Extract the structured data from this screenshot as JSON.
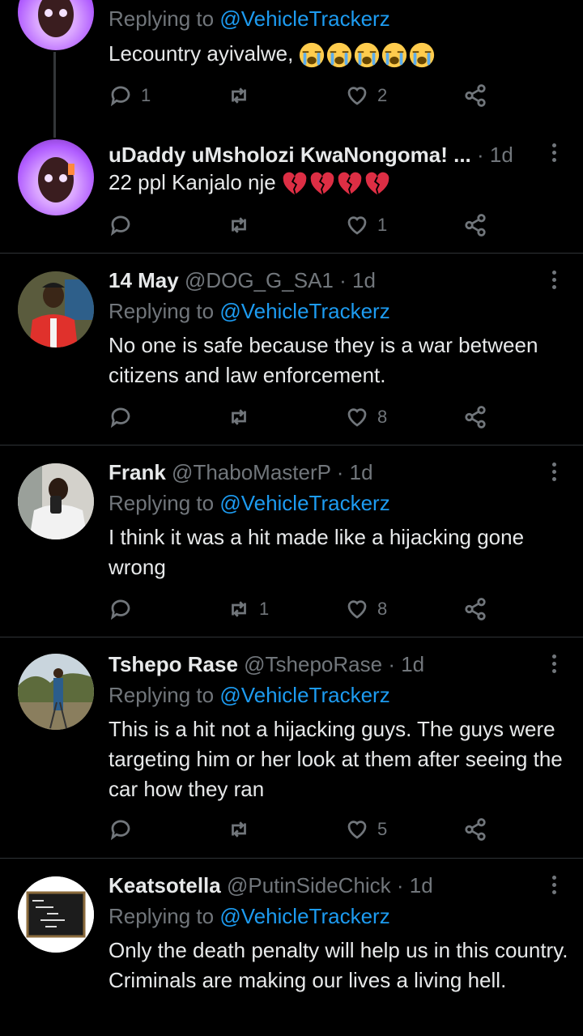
{
  "tweets": [
    {
      "reply_prefix": "Replying to",
      "reply_to": "@VehicleTrackerz",
      "text": "Lecountry ayivalwe,",
      "emoji": [
        "loudly-crying-face",
        "loudly-crying-face",
        "loudly-crying-face",
        "loudly-crying-face",
        "loudly-crying-face"
      ],
      "replies": "1",
      "retweets": "",
      "likes": "2"
    },
    {
      "name": "uDaddy uMsholozi KwaNongoma! ...",
      "meta": "· 1d",
      "text": "22 ppl Kanjalo nje",
      "emoji": [
        "broken-heart",
        "broken-heart",
        "broken-heart",
        "broken-heart"
      ],
      "replies": "",
      "retweets": "",
      "likes": "1"
    },
    {
      "name": "14 May",
      "handle": "@DOG_G_SA1",
      "meta": "· 1d",
      "reply_prefix": "Replying to",
      "reply_to": "@VehicleTrackerz",
      "text": "No one is safe because they is a war between citizens and law enforcement.",
      "replies": "",
      "retweets": "",
      "likes": "8"
    },
    {
      "name": "Frank",
      "handle": "@ThaboMasterP",
      "meta": "· 1d",
      "reply_prefix": "Replying to",
      "reply_to": "@VehicleTrackerz",
      "text": "I think it was a hit made like a hijacking gone wrong",
      "replies": "",
      "retweets": "1",
      "likes": "8"
    },
    {
      "name": "Tshepo Rase",
      "handle": "@TshepoRase",
      "meta": "· 1d",
      "reply_prefix": "Replying to",
      "reply_to": "@VehicleTrackerz",
      "text": "This is a hit not a hijacking guys. The guys were targeting him or her look at them after seeing the car how they ran",
      "replies": "",
      "retweets": "",
      "likes": "5"
    },
    {
      "name": "Keatsotella",
      "handle": "@PutinSideChick",
      "meta": "· 1d",
      "reply_prefix": "Replying to",
      "reply_to": "@VehicleTrackerz",
      "text": "Only the death penalty will help us in this country.  Criminals are making our lives a living hell.",
      "avatar_board_text": "IN A WORLD WHERE YOU CAN BE ANYTHING BE KIND"
    }
  ],
  "colors": {
    "background": "#000000",
    "text": "#e7e9ea",
    "secondary": "#71767b",
    "link": "#1d9bf0",
    "divider": "#2f3336"
  }
}
